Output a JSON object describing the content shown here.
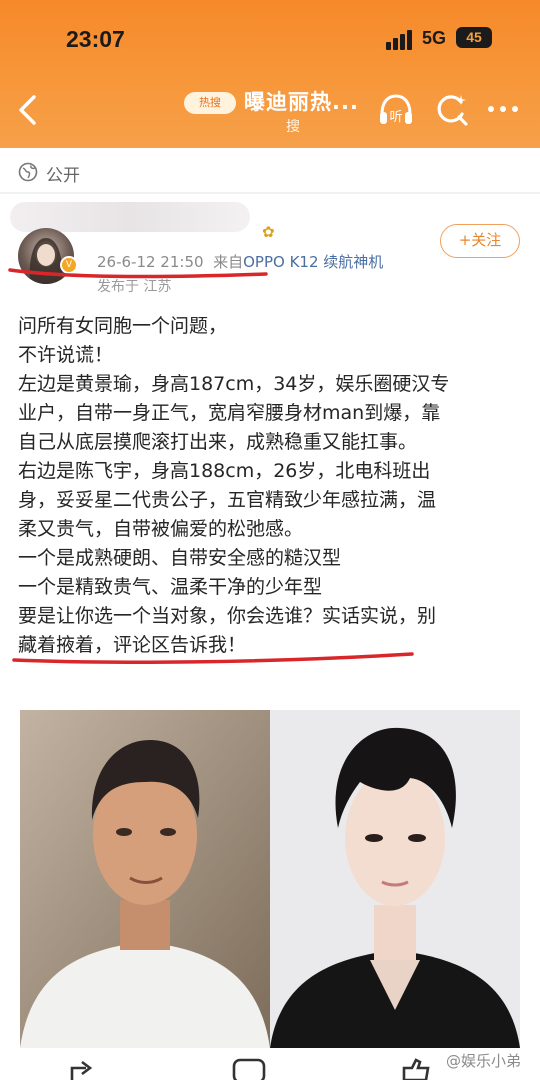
{
  "status_bar": {
    "time": "23:07",
    "network": "5G",
    "battery": "45"
  },
  "nav": {
    "hot_badge": "热搜",
    "topic_title": "曝迪丽热...",
    "subline": "搜",
    "icons": [
      "back-icon",
      "listen-icon",
      "search-icon",
      "more-icon"
    ],
    "listen_label": "听"
  },
  "post": {
    "visibility": "公开",
    "timestamp": "26-6-12 21:50",
    "source_prefix": "来自",
    "device": "OPPO K12 续航神机",
    "location": "发布于 江苏",
    "follow_button": "+关注",
    "body_lines": [
      "问所有女同胞一个问题，",
      "不许说谎！",
      "左边是黄景瑜，身高187cm，34岁，娱乐圈硬汉专",
      "业户，自带一身正气，宽肩窄腰身材man到爆，靠",
      "自己从底层摸爬滚打出来，成熟稳重又能扛事。",
      "右边是陈飞宇，身高188cm，26岁，北电科班出",
      "身，妥妥星二代贵公子，五官精致少年感拉满，温",
      "柔又贵气，自带被偏爱的松弛感。",
      "一个是成熟硬朗、自带安全感的糙汉型",
      "一个是精致贵气、温柔干净的少年型",
      "要是让你选一个当对象，你会选谁？实话实说，别",
      "藏着掖着，评论区告诉我！"
    ]
  },
  "colors": {
    "header_orange": "#f6892a",
    "follow_orange": "#e8862f",
    "annotation_red": "#d9262b",
    "device_blue": "#4a6fa5"
  },
  "watermark": "@娱乐小弟",
  "bottom_icons": [
    "share-icon",
    "comment-icon",
    "like-icon"
  ]
}
